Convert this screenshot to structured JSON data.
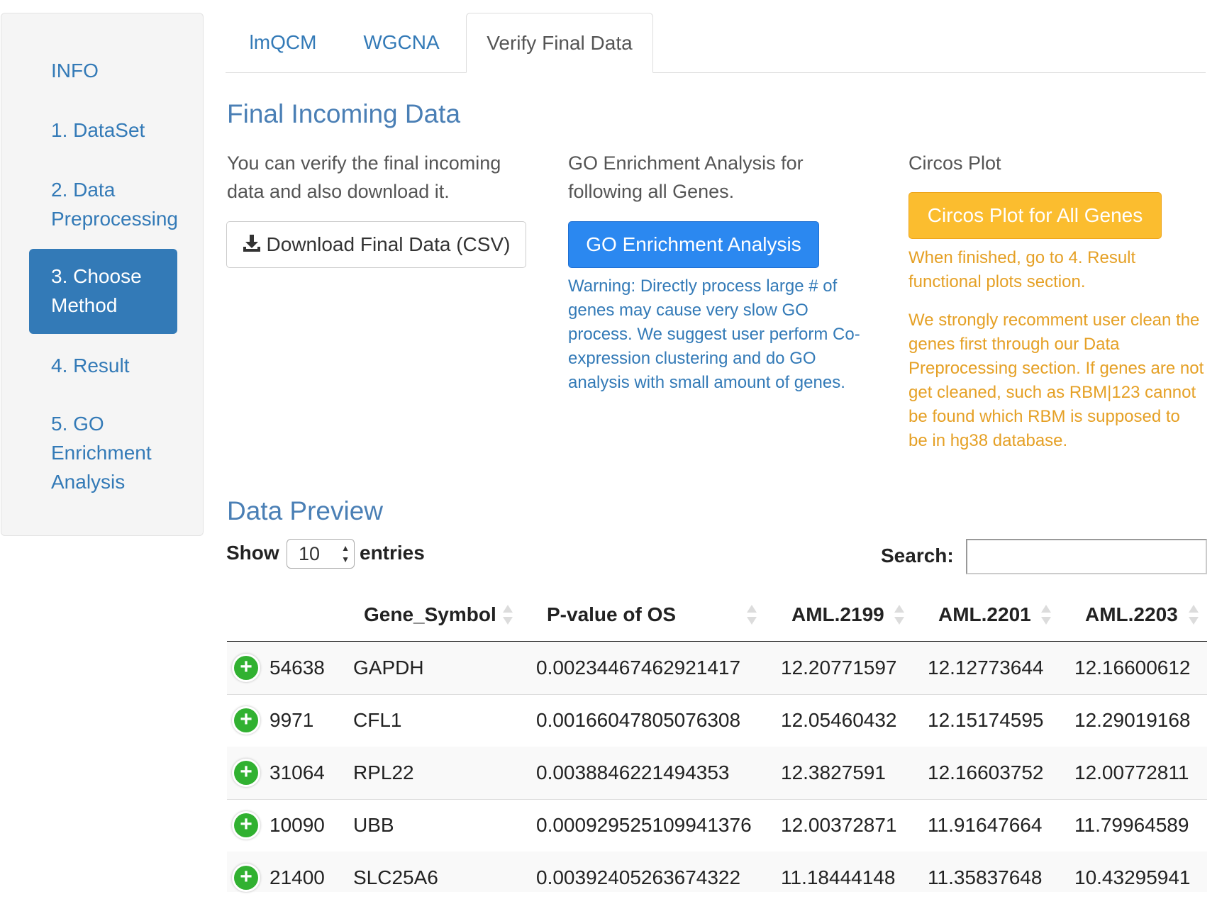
{
  "sidebar": {
    "items": [
      {
        "label": "INFO"
      },
      {
        "label": "1. DataSet"
      },
      {
        "label_line1": "2. Data",
        "label_line2": "Preprocessing"
      },
      {
        "label_line1": "3. Choose",
        "label_line2": "Method",
        "active": true
      },
      {
        "label": "4. Result"
      },
      {
        "label_line1": "5. GO",
        "label_line2": "Enrichment",
        "label_line3": "Analysis"
      }
    ]
  },
  "tabs": [
    {
      "label": "lmQCM"
    },
    {
      "label": "WGCNA"
    },
    {
      "label": "Verify Final Data",
      "active": true
    }
  ],
  "final": {
    "title": "Final Incoming Data",
    "desc_line1": "You can verify the final incoming",
    "desc_line2": "data and also download it.",
    "download_label": "Download Final Data (CSV)",
    "download_icon": "download-icon"
  },
  "go": {
    "desc_line1": "GO Enrichment Analysis for",
    "desc_line2": "following all Genes.",
    "button_label": "GO Enrichment Analysis",
    "warning": [
      "Warning: Directly process large # of",
      "genes may cause very slow GO",
      "process. We suggest user perform Co-",
      "expression clustering and do GO",
      "analysis with small amount of genes."
    ]
  },
  "circos": {
    "title": "Circos Plot",
    "button_label": "Circos Plot for All Genes",
    "note1": [
      "When finished, go to 4. Result",
      "functional plots section."
    ],
    "note2": [
      "We strongly recomment user clean the",
      "genes first through our Data",
      "Preprocessing section. If genes are not",
      "get cleaned, such as RBM|123 cannot",
      "be found which RBM is supposed to",
      "be in hg38 database."
    ]
  },
  "preview": {
    "title": "Data Preview",
    "show_label": "Show",
    "entries_value": "10",
    "entries_label": "entries",
    "search_label": "Search:",
    "search_value": "",
    "columns": [
      "",
      "Gene_Symbol",
      "P-value of OS",
      "AML.2199",
      "AML.2201",
      "AML.2203"
    ],
    "rows": [
      [
        "54638",
        "GAPDH",
        "0.00234467462921417",
        "12.20771597",
        "12.12773644",
        "12.16600612"
      ],
      [
        "9971",
        "CFL1",
        "0.00166047805076308",
        "12.05460432",
        "12.15174595",
        "12.29019168"
      ],
      [
        "31064",
        "RPL22",
        "0.0038846221494353",
        "12.3827591",
        "12.16603752",
        "12.00772811"
      ],
      [
        "10090",
        "UBB",
        "0.000929525109941376",
        "12.00372871",
        "11.91647664",
        "11.79964589"
      ],
      [
        "21400",
        "SLC25A6",
        "0.00392405263674322",
        "11.18444148",
        "11.35837648",
        "10.43295941"
      ]
    ]
  },
  "colors": {
    "primary": "#337ab7",
    "go_button": "#2b88f0",
    "warning_button": "#fbbd2f",
    "orange_text": "#e5a025",
    "expand_green": "#31b131"
  }
}
